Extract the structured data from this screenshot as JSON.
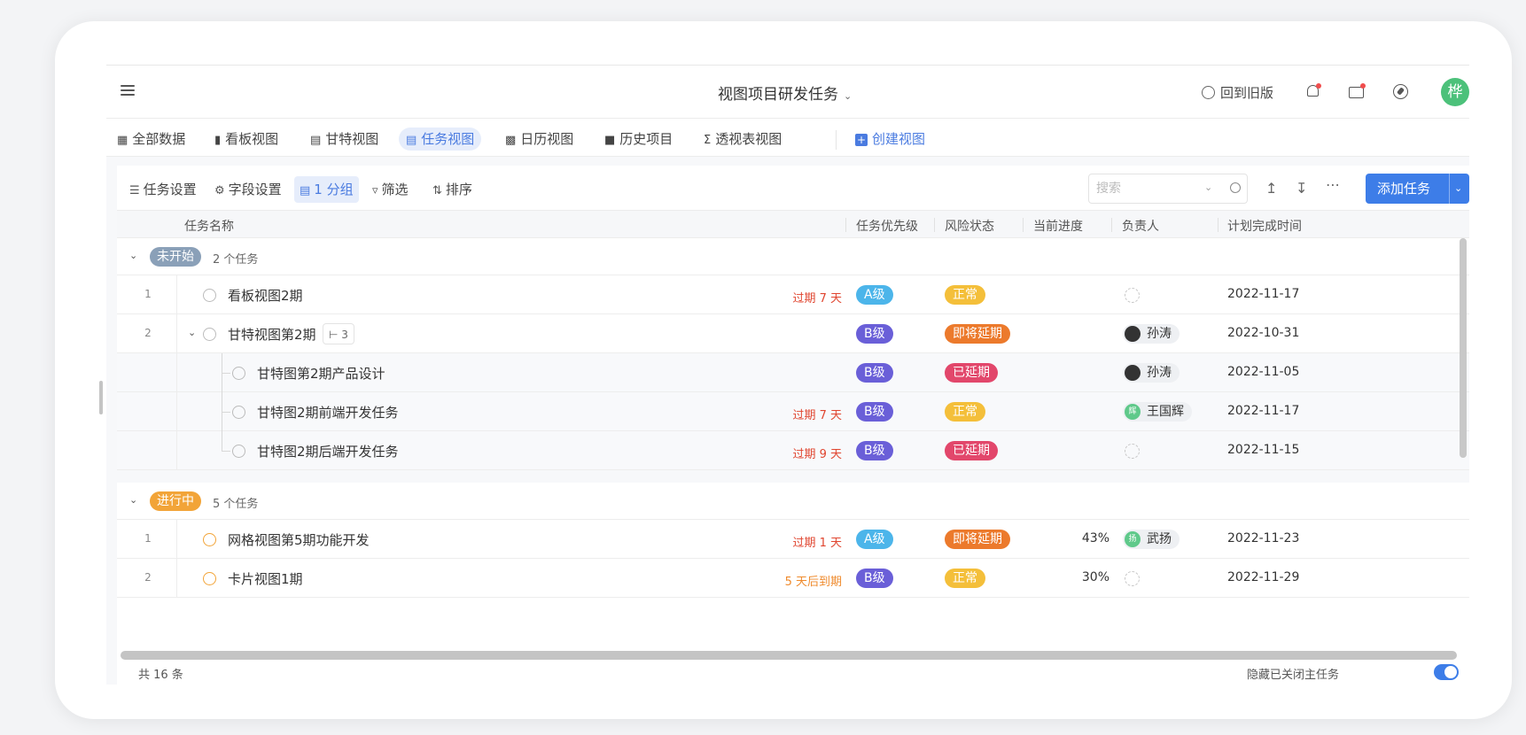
{
  "header": {
    "title": "视图项目研发任务",
    "back_old": "回到旧版",
    "avatar_initial": "桦"
  },
  "views": [
    {
      "label": "全部数据",
      "icon": "grid-icon"
    },
    {
      "label": "看板视图",
      "icon": "kanban-icon"
    },
    {
      "label": "甘特视图",
      "icon": "gantt-icon"
    },
    {
      "label": "任务视图",
      "icon": "task-list-icon"
    },
    {
      "label": "日历视图",
      "icon": "calendar-icon"
    },
    {
      "label": "历史项目",
      "icon": "folder-icon"
    },
    {
      "label": "透视表视图",
      "icon": "pivot-icon"
    },
    {
      "label": "创建视图",
      "icon": "plus-icon"
    }
  ],
  "toolbar": {
    "task_settings": "任务设置",
    "field_settings": "字段设置",
    "group": "1 分组",
    "filter": "筛选",
    "sort": "排序",
    "search_placeholder": "搜索",
    "add_task": "添加任务"
  },
  "columns": {
    "name": "任务名称",
    "priority": "任务优先级",
    "risk": "风险状态",
    "progress": "当前进度",
    "owner": "负责人",
    "due": "计划完成时间"
  },
  "groups": [
    {
      "status": "未开始",
      "count_label": "2 个任务",
      "color": "#8aa0b8",
      "tasks": [
        {
          "num": "1",
          "name": "看板视图2期",
          "overdue": "过期 7 天",
          "priority": "A级",
          "risk": "正常",
          "progress": "",
          "owner": "",
          "due": "2022-11-17"
        },
        {
          "num": "2",
          "name": "甘特视图第2期",
          "subtask_count": "3",
          "overdue": "",
          "priority": "B级",
          "risk": "即将延期",
          "progress": "",
          "owner": "孙涛",
          "due": "2022-10-31",
          "subtasks": [
            {
              "name": "甘特图第2期产品设计",
              "overdue": "",
              "priority": "B级",
              "risk": "已延期",
              "owner": "孙涛",
              "due": "2022-11-05"
            },
            {
              "name": "甘特图2期前端开发任务",
              "overdue": "过期 7 天",
              "priority": "B级",
              "risk": "正常",
              "owner": "王国辉",
              "due": "2022-11-17"
            },
            {
              "name": "甘特图2期后端开发任务",
              "overdue": "过期 9 天",
              "priority": "B级",
              "risk": "已延期",
              "owner": "",
              "due": "2022-11-15"
            }
          ]
        }
      ]
    },
    {
      "status": "进行中",
      "count_label": "5 个任务",
      "color": "#f2a438",
      "tasks": [
        {
          "num": "1",
          "name": "网格视图第5期功能开发",
          "overdue": "过期 1 天",
          "priority": "A级",
          "risk": "即将延期",
          "progress": "43%",
          "owner": "武扬",
          "due": "2022-11-23"
        },
        {
          "num": "2",
          "name": "卡片视图1期",
          "overdue": "5 天后到期",
          "priority": "B级",
          "risk": "正常",
          "progress": "30%",
          "owner": "",
          "due": "2022-11-29"
        }
      ]
    }
  ],
  "avatar_initials": {
    "wang": "辉",
    "wu": "扬"
  },
  "footer": {
    "total": "共 16 条",
    "hide_closed": "隐藏已关闭主任务"
  },
  "colors": {
    "accent": "#3d7de8",
    "priority_a": "#4cb5ea",
    "priority_b": "#6a5fd8",
    "risk_normal": "#f4bf3a",
    "risk_soon": "#ec7a2c",
    "risk_delayed": "#e2476b",
    "overdue": "#e0452f",
    "due_soon": "#ef8a2c"
  }
}
